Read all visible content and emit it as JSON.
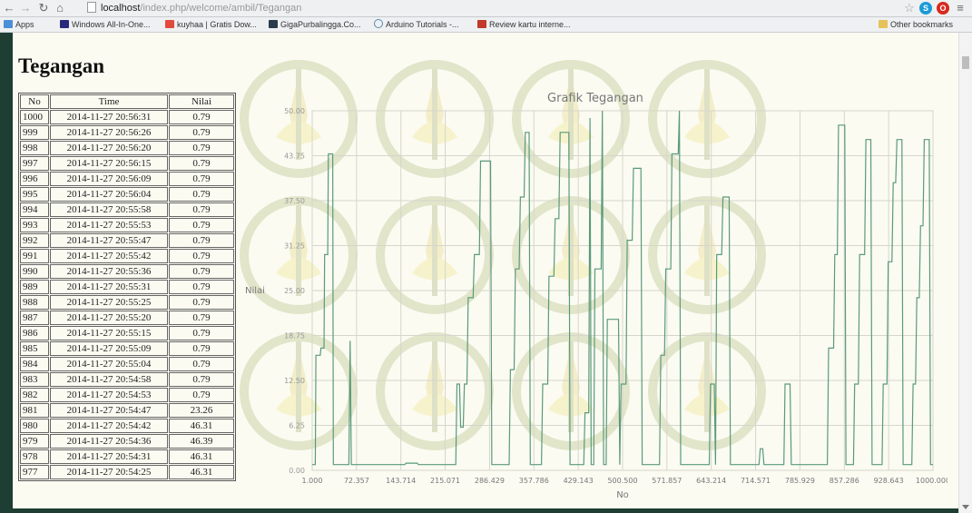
{
  "browser": {
    "url_host": "localhost",
    "url_path": "/index.php/welcome/ambil/Tegangan",
    "bookmarks": [
      {
        "label": "Apps",
        "color": "#4a8fd8"
      },
      {
        "label": "Windows All-In-One...",
        "color": "#2a2a7a"
      },
      {
        "label": "kuyhaa | Gratis Dow...",
        "color": "#e24a3b"
      },
      {
        "label": "GigaPurbalingga.Co...",
        "color": "#2a3a4a"
      },
      {
        "label": "Arduino Tutorials -...",
        "color": "#5a8ab0"
      },
      {
        "label": "Review kartu interne...",
        "color": "#c0392b"
      }
    ],
    "other_bookmarks": "Other bookmarks"
  },
  "page": {
    "title": "Tegangan"
  },
  "table": {
    "headers": [
      "No",
      "Time",
      "Nilai"
    ],
    "rows": [
      [
        "1000",
        "2014-11-27 20:56:31",
        "0.79"
      ],
      [
        "999",
        "2014-11-27 20:56:26",
        "0.79"
      ],
      [
        "998",
        "2014-11-27 20:56:20",
        "0.79"
      ],
      [
        "997",
        "2014-11-27 20:56:15",
        "0.79"
      ],
      [
        "996",
        "2014-11-27 20:56:09",
        "0.79"
      ],
      [
        "995",
        "2014-11-27 20:56:04",
        "0.79"
      ],
      [
        "994",
        "2014-11-27 20:55:58",
        "0.79"
      ],
      [
        "993",
        "2014-11-27 20:55:53",
        "0.79"
      ],
      [
        "992",
        "2014-11-27 20:55:47",
        "0.79"
      ],
      [
        "991",
        "2014-11-27 20:55:42",
        "0.79"
      ],
      [
        "990",
        "2014-11-27 20:55:36",
        "0.79"
      ],
      [
        "989",
        "2014-11-27 20:55:31",
        "0.79"
      ],
      [
        "988",
        "2014-11-27 20:55:25",
        "0.79"
      ],
      [
        "987",
        "2014-11-27 20:55:20",
        "0.79"
      ],
      [
        "986",
        "2014-11-27 20:55:15",
        "0.79"
      ],
      [
        "985",
        "2014-11-27 20:55:09",
        "0.79"
      ],
      [
        "984",
        "2014-11-27 20:55:04",
        "0.79"
      ],
      [
        "983",
        "2014-11-27 20:54:58",
        "0.79"
      ],
      [
        "982",
        "2014-11-27 20:54:53",
        "0.79"
      ],
      [
        "981",
        "2014-11-27 20:54:47",
        "23.26"
      ],
      [
        "980",
        "2014-11-27 20:54:42",
        "46.31"
      ],
      [
        "979",
        "2014-11-27 20:54:36",
        "46.39"
      ],
      [
        "978",
        "2014-11-27 20:54:31",
        "46.31"
      ],
      [
        "977",
        "2014-11-27 20:54:25",
        "46.31"
      ]
    ]
  },
  "chart_data": {
    "type": "line",
    "title": "Grafik Tegangan",
    "xlabel": "No",
    "ylabel": "Nilai",
    "xlim": [
      1,
      1000
    ],
    "ylim": [
      0,
      50
    ],
    "x_ticks": [
      "1.000",
      "72.357",
      "143.714",
      "215.071",
      "286.429",
      "357.786",
      "429.143",
      "500.500",
      "571.857",
      "643.214",
      "714.571",
      "785.929",
      "857.286",
      "928.643",
      "1000.000"
    ],
    "y_ticks": [
      "0.00",
      "6.25",
      "12.50",
      "18.75",
      "25.00",
      "31.25",
      "37.50",
      "43.75",
      "50.00"
    ],
    "grid": true,
    "line_color": "#5a9a7a",
    "series": [
      {
        "values": [
          [
            1,
            0.79
          ],
          [
            6,
            0.79
          ],
          [
            7,
            16
          ],
          [
            14,
            16
          ],
          [
            15,
            17
          ],
          [
            20,
            17
          ],
          [
            21,
            30
          ],
          [
            26,
            30
          ],
          [
            27,
            44
          ],
          [
            34,
            44
          ],
          [
            35,
            0.79
          ],
          [
            60,
            0.79
          ],
          [
            62,
            18
          ],
          [
            64,
            0.79
          ],
          [
            118,
            0.79
          ],
          [
            150,
            0.79
          ],
          [
            152,
            1
          ],
          [
            170,
            1
          ],
          [
            172,
            0.79
          ],
          [
            232,
            0.79
          ],
          [
            234,
            12
          ],
          [
            238,
            12
          ],
          [
            240,
            6
          ],
          [
            244,
            6
          ],
          [
            246,
            12
          ],
          [
            250,
            12
          ],
          [
            252,
            24
          ],
          [
            260,
            24
          ],
          [
            262,
            30
          ],
          [
            270,
            30
          ],
          [
            272,
            43
          ],
          [
            288,
            43
          ],
          [
            290,
            0.79
          ],
          [
            318,
            0.79
          ],
          [
            320,
            14
          ],
          [
            326,
            14
          ],
          [
            328,
            28
          ],
          [
            334,
            28
          ],
          [
            336,
            38
          ],
          [
            342,
            38
          ],
          [
            344,
            47
          ],
          [
            350,
            47
          ],
          [
            352,
            0.79
          ],
          [
            370,
            0.79
          ],
          [
            372,
            12
          ],
          [
            380,
            12
          ],
          [
            382,
            27
          ],
          [
            390,
            27
          ],
          [
            392,
            35
          ],
          [
            398,
            35
          ],
          [
            400,
            47
          ],
          [
            414,
            47
          ],
          [
            416,
            0.79
          ],
          [
            438,
            0.79
          ],
          [
            440,
            8
          ],
          [
            446,
            8
          ],
          [
            448,
            49
          ],
          [
            450,
            0.79
          ],
          [
            454,
            0.79
          ],
          [
            456,
            28
          ],
          [
            466,
            28
          ],
          [
            468,
            50
          ],
          [
            470,
            0.79
          ],
          [
            474,
            0.79
          ],
          [
            476,
            21
          ],
          [
            494,
            21
          ],
          [
            496,
            0.79
          ],
          [
            498,
            12
          ],
          [
            506,
            12
          ],
          [
            508,
            32
          ],
          [
            516,
            32
          ],
          [
            518,
            42
          ],
          [
            530,
            42
          ],
          [
            532,
            0.79
          ],
          [
            560,
            0.79
          ],
          [
            562,
            16
          ],
          [
            568,
            16
          ],
          [
            570,
            28
          ],
          [
            578,
            28
          ],
          [
            580,
            44
          ],
          [
            590,
            44
          ],
          [
            592,
            50
          ],
          [
            594,
            0.79
          ],
          [
            640,
            0.79
          ],
          [
            642,
            12
          ],
          [
            648,
            12
          ],
          [
            650,
            0.79
          ],
          [
            652,
            30
          ],
          [
            660,
            30
          ],
          [
            662,
            38
          ],
          [
            672,
            38
          ],
          [
            674,
            0.79
          ],
          [
            720,
            0.79
          ],
          [
            722,
            3
          ],
          [
            726,
            3
          ],
          [
            728,
            0.79
          ],
          [
            760,
            0.79
          ],
          [
            762,
            12
          ],
          [
            770,
            12
          ],
          [
            772,
            0.79
          ],
          [
            830,
            0.79
          ],
          [
            832,
            17
          ],
          [
            840,
            17
          ],
          [
            842,
            30
          ],
          [
            846,
            30
          ],
          [
            848,
            48
          ],
          [
            858,
            48
          ],
          [
            860,
            0.79
          ],
          [
            872,
            0.79
          ],
          [
            874,
            12
          ],
          [
            880,
            12
          ],
          [
            882,
            30
          ],
          [
            890,
            30
          ],
          [
            892,
            46
          ],
          [
            900,
            46
          ],
          [
            902,
            0.79
          ],
          [
            918,
            0.79
          ],
          [
            920,
            12
          ],
          [
            926,
            12
          ],
          [
            928,
            29
          ],
          [
            934,
            29
          ],
          [
            936,
            40
          ],
          [
            940,
            40
          ],
          [
            942,
            46
          ],
          [
            950,
            46
          ],
          [
            952,
            0.79
          ],
          [
            966,
            0.79
          ],
          [
            968,
            12
          ],
          [
            972,
            12
          ],
          [
            974,
            24
          ],
          [
            978,
            24
          ],
          [
            980,
            34
          ],
          [
            984,
            34
          ],
          [
            986,
            46
          ],
          [
            994,
            46
          ],
          [
            996,
            0.79
          ],
          [
            1000,
            0.79
          ]
        ]
      }
    ]
  }
}
